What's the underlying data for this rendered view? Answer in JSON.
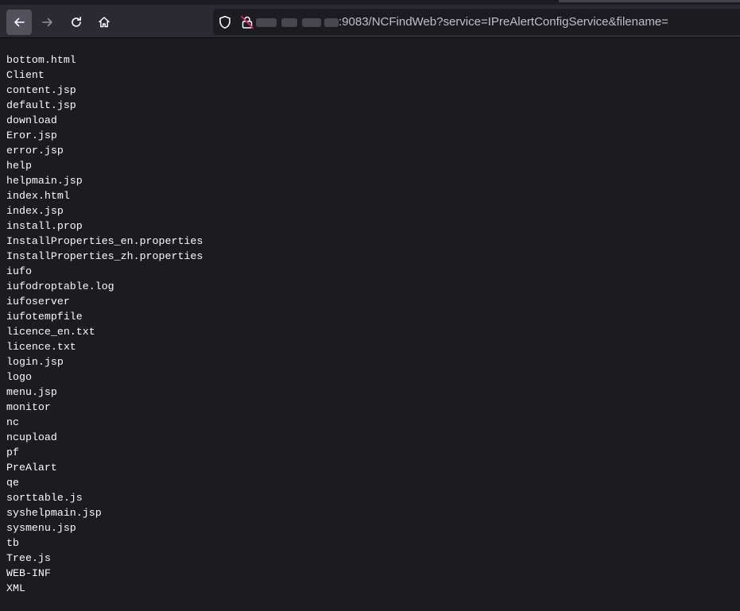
{
  "browser": {
    "url_visible": ":9083/NCFindWeb?service=IPreAlertConfigService&filename=",
    "icons": [
      "back-arrow-icon",
      "forward-arrow-icon",
      "reload-icon",
      "home-icon",
      "tracking-shield-icon",
      "insecure-lock-icon"
    ]
  },
  "listing": {
    "entries": [
      "bottom.html",
      "Client",
      "content.jsp",
      "default.jsp",
      "download",
      "Eror.jsp",
      "error.jsp",
      "help",
      "helpmain.jsp",
      "index.html",
      "index.jsp",
      "install.prop",
      "InstallProperties_en.properties",
      "InstallProperties_zh.properties",
      "iufo",
      "iufodroptable.log",
      "iufoserver",
      "iufotempfile",
      "licence_en.txt",
      "licence.txt",
      "login.jsp",
      "logo",
      "menu.jsp",
      "monitor",
      "nc",
      "ncupload",
      "pf",
      "PreAlart",
      "qe",
      "sorttable.js",
      "syshelpmain.jsp",
      "sysmenu.jsp",
      "tb",
      "Tree.js",
      "WEB-INF",
      "XML"
    ]
  },
  "colors": {
    "page_background": "#1c1b22",
    "toolbar_background": "#2b2a33",
    "text": "#fbfbfe"
  }
}
